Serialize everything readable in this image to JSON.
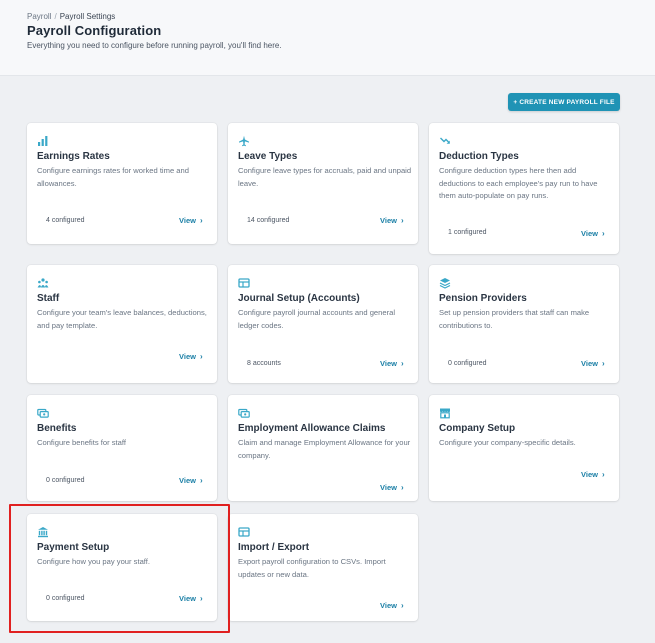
{
  "breadcrumb": {
    "parent": "Payroll",
    "separator": "/",
    "current": "Payroll Settings"
  },
  "page": {
    "title": "Payroll Configuration",
    "subtitle": "Everything you need to configure before running payroll, you'll find here."
  },
  "actions": {
    "create_label": "+ CREATE NEW PAYROLL FILE"
  },
  "colors": {
    "accent": "#1f93b5",
    "link": "#1b7fa6",
    "highlight": "#e02020"
  },
  "cards": [
    {
      "icon": "bar-chart-icon",
      "title": "Earnings Rates",
      "description": "Configure earnings rates for worked time and allowances.",
      "count": "4 configured",
      "view": "View"
    },
    {
      "icon": "airplane-icon",
      "title": "Leave Types",
      "description": "Configure leave types for accruals, paid and unpaid leave.",
      "count": "14 configured",
      "view": "View"
    },
    {
      "icon": "arrow-down-right-icon",
      "title": "Deduction Types",
      "description": "Configure deduction types here then add deductions to each employee's pay run to have them auto-populate on pay runs.",
      "count": "1 configured",
      "view": "View"
    },
    {
      "icon": "people-icon",
      "title": "Staff",
      "description": "Configure your team's leave balances, deductions, and pay template.",
      "count": "",
      "view": "View"
    },
    {
      "icon": "ledger-icon",
      "title": "Journal Setup (Accounts)",
      "description": "Configure payroll journal accounts and general ledger codes.",
      "count": "8 accounts",
      "view": "View"
    },
    {
      "icon": "layers-icon",
      "title": "Pension Providers",
      "description": "Set up pension providers that staff can make contributions to.",
      "count": "0 configured",
      "view": "View"
    },
    {
      "icon": "money-icon",
      "title": "Benefits",
      "description": "Configure benefits for staff",
      "count": "0 configured",
      "view": "View"
    },
    {
      "icon": "money-icon",
      "title": "Employment Allowance Claims",
      "description": "Claim and manage Employment Allowance for your company.",
      "count": "",
      "view": "View"
    },
    {
      "icon": "store-icon",
      "title": "Company Setup",
      "description": "Configure your company-specific details.",
      "count": "",
      "view": "View"
    },
    {
      "icon": "bank-icon",
      "title": "Payment Setup",
      "description": "Configure how you pay your staff.",
      "count": "0 configured",
      "view": "View"
    },
    {
      "icon": "ledger-icon",
      "title": "Import / Export",
      "description": "Export payroll configuration to CSVs. Import updates or new data.",
      "count": "",
      "view": "View"
    }
  ]
}
